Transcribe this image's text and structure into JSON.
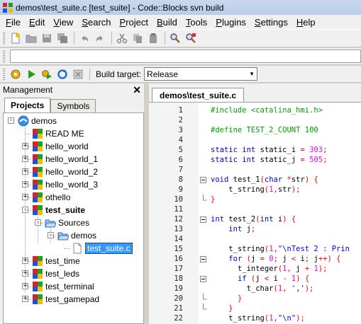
{
  "window": {
    "title": "demos\\test_suite.c [test_suite] - Code::Blocks svn build"
  },
  "menu": [
    {
      "u": "F",
      "rest": "ile"
    },
    {
      "u": "E",
      "rest": "dit"
    },
    {
      "u": "V",
      "rest": "iew"
    },
    {
      "u": "S",
      "rest": "earch"
    },
    {
      "u": "P",
      "rest": "roject"
    },
    {
      "u": "B",
      "rest": "uild"
    },
    {
      "u": "T",
      "rest": "ools"
    },
    {
      "u": "P",
      "rest": "lugins"
    },
    {
      "u": "S",
      "rest": "ettings"
    },
    {
      "u": "H",
      "rest": "elp"
    }
  ],
  "build_toolbar": {
    "label": "Build target:",
    "target": "Release"
  },
  "management": {
    "title": "Management",
    "tabs": [
      "Projects",
      "Symbols"
    ],
    "tree": [
      {
        "label": "demos",
        "kind": "workspace"
      },
      {
        "label": "READ ME",
        "kind": "project"
      },
      {
        "label": "hello_world",
        "kind": "project"
      },
      {
        "label": "hello_world_1",
        "kind": "project"
      },
      {
        "label": "hello_world_2",
        "kind": "project"
      },
      {
        "label": "hello_world_3",
        "kind": "project"
      },
      {
        "label": "othello",
        "kind": "project"
      },
      {
        "label": "test_suite",
        "kind": "project"
      },
      {
        "label": "Sources",
        "kind": "folder"
      },
      {
        "label": "demos",
        "kind": "folder"
      },
      {
        "label": "test_suite.c",
        "kind": "file"
      },
      {
        "label": "test_time",
        "kind": "project"
      },
      {
        "label": "test_leds",
        "kind": "project"
      },
      {
        "label": "test_terminal",
        "kind": "project"
      },
      {
        "label": "test_gamepad",
        "kind": "project"
      }
    ]
  },
  "editor": {
    "tab": "demos\\test_suite.c",
    "lines": [
      {
        "n": "1",
        "t": "#include <catalina_hmi.h>"
      },
      {
        "n": "2",
        "t": ""
      },
      {
        "n": "3",
        "t": "#define TEST_2_COUNT 100"
      },
      {
        "n": "4",
        "t": ""
      },
      {
        "n": "5",
        "t": "static int static_i = 303;"
      },
      {
        "n": "6",
        "t": "static int static_j = 505;"
      },
      {
        "n": "7",
        "t": ""
      },
      {
        "n": "8",
        "t": "void test_1(char *str) {"
      },
      {
        "n": "9",
        "t": "    t_string(1,str);"
      },
      {
        "n": "10",
        "t": "}"
      },
      {
        "n": "11",
        "t": ""
      },
      {
        "n": "12",
        "t": "int test_2(int i) {"
      },
      {
        "n": "13",
        "t": "    int j;"
      },
      {
        "n": "14",
        "t": ""
      },
      {
        "n": "15",
        "t": "    t_string(1,\"\\nTest 2 : Prin"
      },
      {
        "n": "16",
        "t": "    for (j = 0; j < i; j++) {"
      },
      {
        "n": "17",
        "t": "      t_integer(1, j + 1);"
      },
      {
        "n": "18",
        "t": "      if (j < i - 1) {"
      },
      {
        "n": "19",
        "t": "        t_char(1, ',');"
      },
      {
        "n": "20",
        "t": "      }"
      },
      {
        "n": "21",
        "t": "    }"
      },
      {
        "n": "22",
        "t": "    t_string(1,\"\\n\");"
      }
    ]
  }
}
